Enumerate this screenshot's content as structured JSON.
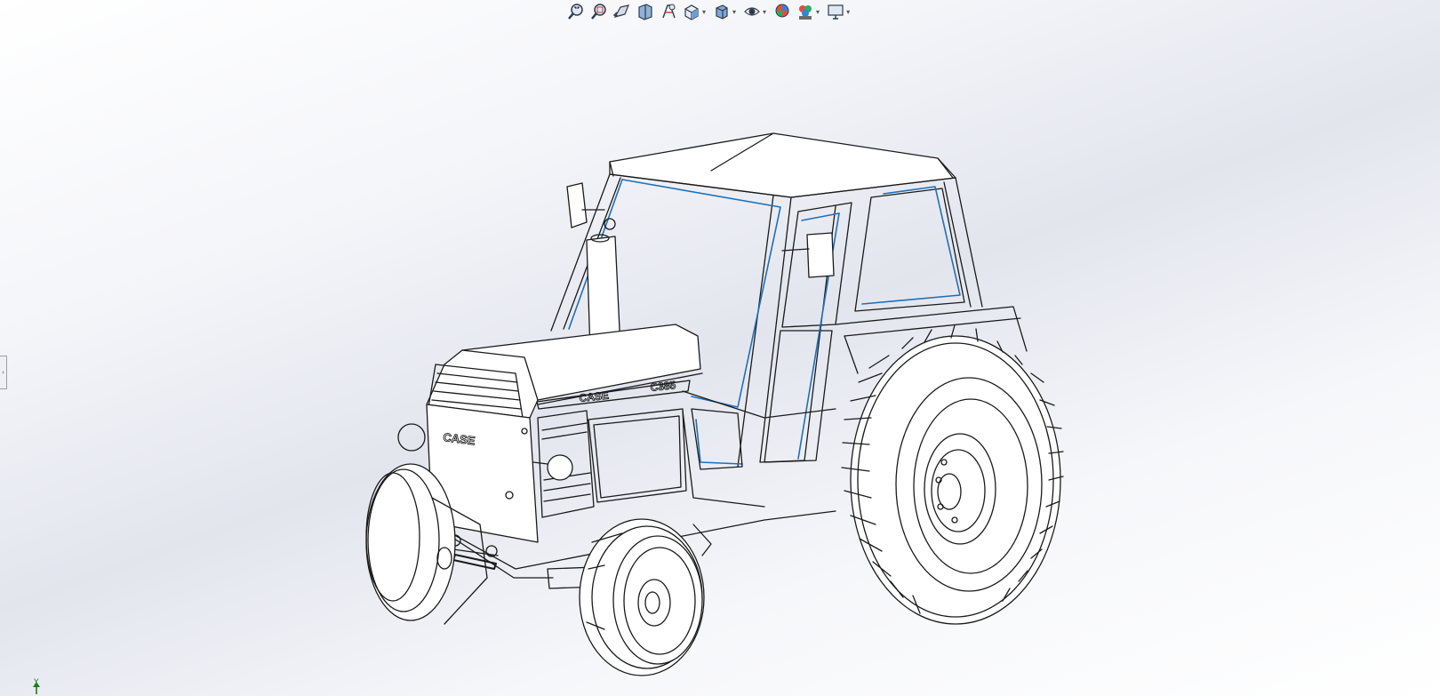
{
  "toolbar": {
    "buttons": [
      {
        "icon": "zoom-to-fit-icon",
        "has_menu": false
      },
      {
        "icon": "zoom-to-area-icon",
        "has_menu": false
      },
      {
        "icon": "previous-view-icon",
        "has_menu": false
      },
      {
        "icon": "section-view-icon",
        "has_menu": false
      },
      {
        "icon": "dynamic-annotation-views-icon",
        "has_menu": false
      },
      {
        "icon": "view-orientation-icon",
        "has_menu": true
      },
      {
        "icon": "display-style-icon",
        "has_menu": true
      },
      {
        "icon": "hide-show-items-icon",
        "has_menu": true
      },
      {
        "icon": "edit-appearance-icon",
        "has_menu": false
      },
      {
        "icon": "apply-scene-icon",
        "has_menu": true
      },
      {
        "icon": "view-settings-icon",
        "has_menu": true
      }
    ]
  },
  "model": {
    "hood_badge": "CASE",
    "side_badge_left": "CASE",
    "side_badge_right": "C385"
  },
  "triad": {
    "axis_label": "Y"
  },
  "colors": {
    "edge": "#1a1a1a",
    "selected_edge": "#1f6fb8",
    "triad_green": "#1a7d1a"
  }
}
